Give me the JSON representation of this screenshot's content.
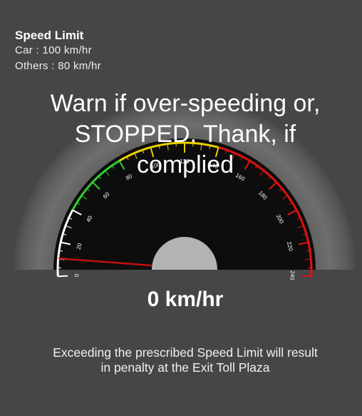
{
  "speed_limit": {
    "title": "Speed Limit",
    "car": "Car : 100 km/hr",
    "others": "Others : 80 km/hr"
  },
  "overlay_message": {
    "line1": "Warn if over-speeding or,",
    "line2": "STOPPED. Thank, if",
    "line3": "complied"
  },
  "gauge": {
    "min": 0,
    "max": 240,
    "needle_value": 0,
    "tick_labels": [
      "0",
      "20",
      "40",
      "60",
      "80",
      "100",
      "120",
      "140",
      "160",
      "180",
      "200",
      "220",
      "240"
    ],
    "zones": [
      {
        "from": 0,
        "to": 40,
        "color": "#ffffff"
      },
      {
        "from": 40,
        "to": 80,
        "color": "#33cc33"
      },
      {
        "from": 80,
        "to": 140,
        "color": "#e8d000"
      },
      {
        "from": 140,
        "to": 240,
        "color": "#e01010"
      }
    ],
    "needle_color": "#c01010"
  },
  "readout": "0 km/hr",
  "notice": {
    "line1": "Exceeding the prescribed Speed Limit will result",
    "line2": "in penalty at the Exit Toll Plaza"
  }
}
